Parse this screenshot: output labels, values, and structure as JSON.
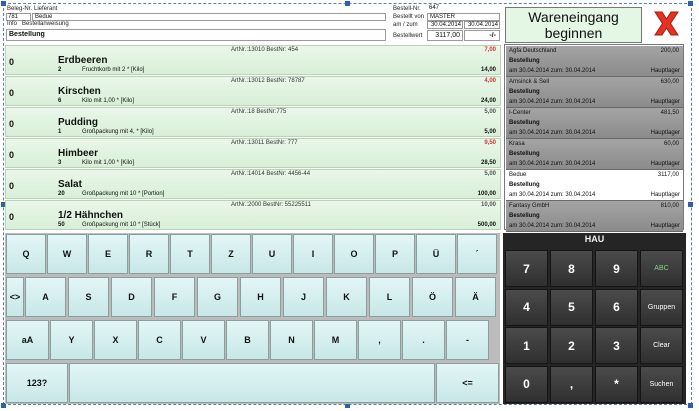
{
  "header": {
    "beleg_label": "Beleg-Nr.",
    "lieferant_label": "Lieferant",
    "beleg_nr": "781",
    "lieferant": "Bedue",
    "info_label": "Info",
    "info": "Bestellanweisung",
    "mode": "Bestellung",
    "bestell_nr_label": "Bestell-Nr.",
    "bestell_nr": "647",
    "bestellt_von_label": "Bestellt von",
    "bestellt_von": "MASTER",
    "am_zum_label": "am / zum",
    "am": "30.04.2014",
    "zum": "30.04.2014",
    "bestellwert_label": "Bestellwert",
    "bestellwert": "3117,00",
    "delta": "-/-"
  },
  "start_button": "Wareneingang beginnen",
  "items": [
    {
      "qty": "0",
      "name": "Erdbeeren",
      "num": "2",
      "desc": "Fruchtkorb mit 2 * [Kilo]",
      "art": "ArtNr.:13010  BestNr: 454",
      "price": "7,00",
      "price_red": true,
      "total": "14,00"
    },
    {
      "qty": "0",
      "name": "Kirschen",
      "num": "6",
      "desc": "Kilo mit 1,00 * [Kilo]",
      "art": "ArtNr.:13012  BestNr: 78787",
      "price": "4,00",
      "price_red": true,
      "total": "24,00"
    },
    {
      "qty": "0",
      "name": "Pudding",
      "num": "1",
      "desc": "Großpackung mit 4, * [Kilo]",
      "art": "ArtNr.:18  BestNr:775",
      "price": "5,00",
      "price_red": false,
      "total": "5,00"
    },
    {
      "qty": "0",
      "name": "Himbeer",
      "num": "3",
      "desc": "Kilo mit 1,00 * [Kilo]",
      "art": "ArtNr.:13011  BestNr: 777",
      "price": "9,50",
      "price_red": true,
      "total": "28,50"
    },
    {
      "qty": "0",
      "name": "Salat",
      "num": "20",
      "desc": "Großpackung mit 10 * [Portion]",
      "art": "ArtNr.:14014  BestNr: 4456-44",
      "price": "5,00",
      "price_red": false,
      "total": "100,00"
    },
    {
      "qty": "0",
      "name": "1/2 Hähnchen",
      "num": "50",
      "desc": "Großpackung mit 10 * [Stück]",
      "art": "ArtNr.:2000  BestNr: 55225511",
      "price": "10,00",
      "price_red": false,
      "total": "500,00"
    }
  ],
  "suppliers": [
    {
      "name": "Agfa Deutschland",
      "amount": "200,00",
      "type": "Bestellung",
      "date": "am 30.04.2014 zum: 30.04.2014",
      "dest": "Hauptlager",
      "selected": false
    },
    {
      "name": "Amsinck & Sell",
      "amount": "630,00",
      "type": "Bestellung",
      "date": "am 30.04.2014 zum: 30.04.2014",
      "dest": "Hauptlager",
      "selected": false
    },
    {
      "name": "I-Center",
      "amount": "481,50",
      "type": "Bestellung",
      "date": "am 30.04.2014 zum: 30.04.2014",
      "dest": "Hauptlager",
      "selected": false
    },
    {
      "name": "Krasa",
      "amount": "60,00",
      "type": "Bestellung",
      "date": "am 30.04.2014 zum: 30.04.2014",
      "dest": "Hauptlager",
      "selected": false
    },
    {
      "name": "Bedue",
      "amount": "3117,00",
      "type": "Bestellung",
      "date": "am 30.04.2014 zum: 30.04.2014",
      "dest": "Hauptlager",
      "selected": true
    },
    {
      "name": "Fantasy GmbH",
      "amount": "810,00",
      "type": "Bestellung",
      "date": "am 30.04.2014 zum: 30.04.2014",
      "dest": "Hauptlager",
      "selected": false
    }
  ],
  "keyboard": {
    "row1": [
      "Q",
      "W",
      "E",
      "R",
      "T",
      "Z",
      "U",
      "I",
      "O",
      "P",
      "Ü",
      "´"
    ],
    "row2": [
      "<>",
      "A",
      "S",
      "D",
      "F",
      "G",
      "H",
      "J",
      "K",
      "L",
      "Ö",
      "Ä"
    ],
    "row3": [
      "aA",
      "Y",
      "X",
      "C",
      "V",
      "B",
      "N",
      "M",
      ",",
      ".",
      "-"
    ],
    "row4": [
      "123?",
      "",
      "<="
    ]
  },
  "numpad": {
    "title": "HAU",
    "keys": [
      [
        "7",
        "8",
        "9",
        "ABC"
      ],
      [
        "4",
        "5",
        "6",
        "Gruppen"
      ],
      [
        "1",
        "2",
        "3",
        "Clear"
      ],
      [
        "0",
        ",",
        "*",
        "Suchen"
      ]
    ]
  },
  "colors": {
    "accent_green": "#e4f6e4",
    "close_red": "#e53322",
    "numpad_bg": "#252525"
  }
}
